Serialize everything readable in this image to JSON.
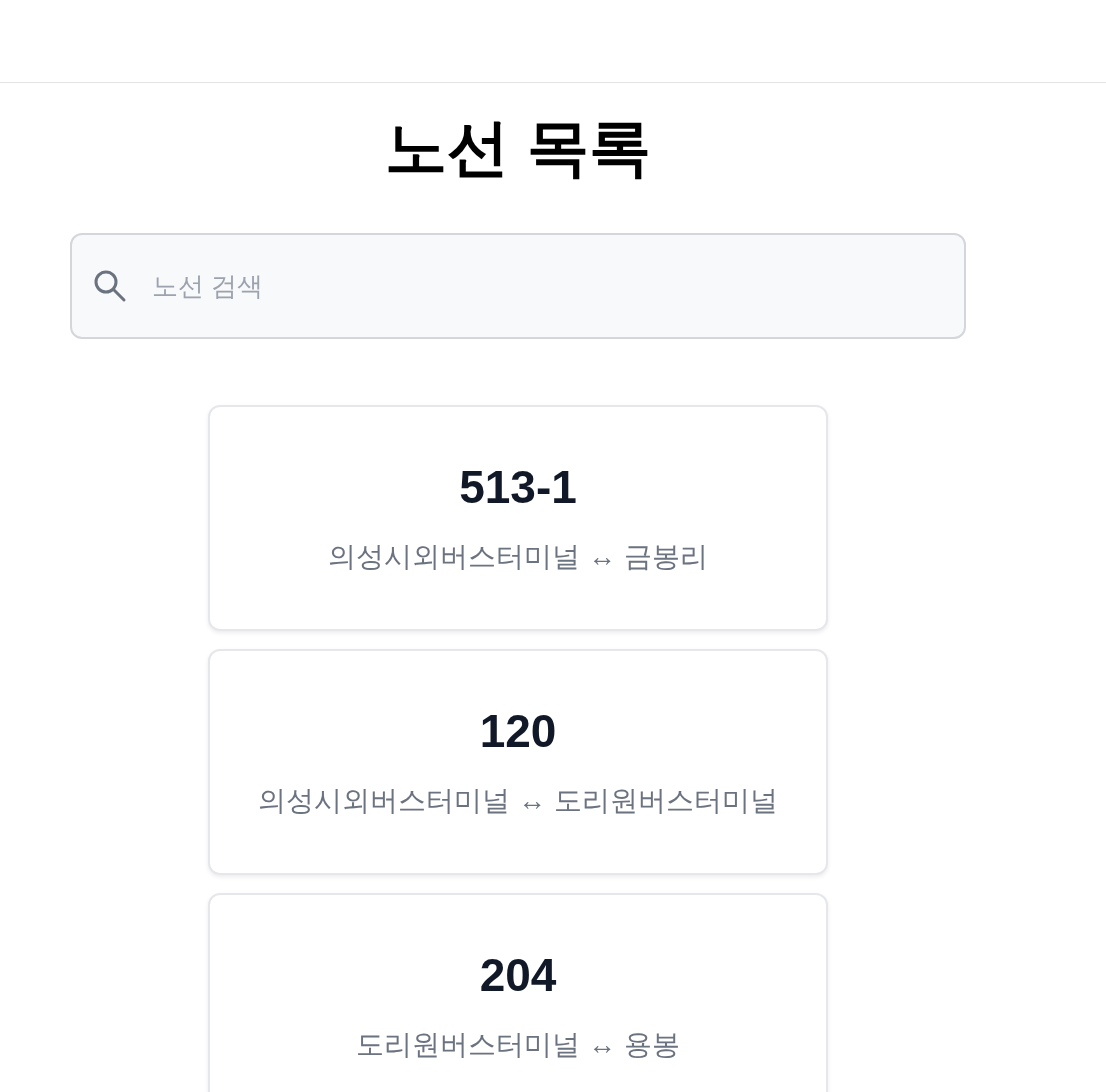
{
  "title": "노선 목록",
  "search": {
    "placeholder": "노선 검색"
  },
  "routes": [
    {
      "number": "513-1",
      "endpoints": "의성시외버스터미널 ↔ 금봉리"
    },
    {
      "number": "120",
      "endpoints": "의성시외버스터미널 ↔ 도리원버스터미널"
    },
    {
      "number": "204",
      "endpoints": "도리원버스터미널 ↔ 용봉"
    }
  ]
}
